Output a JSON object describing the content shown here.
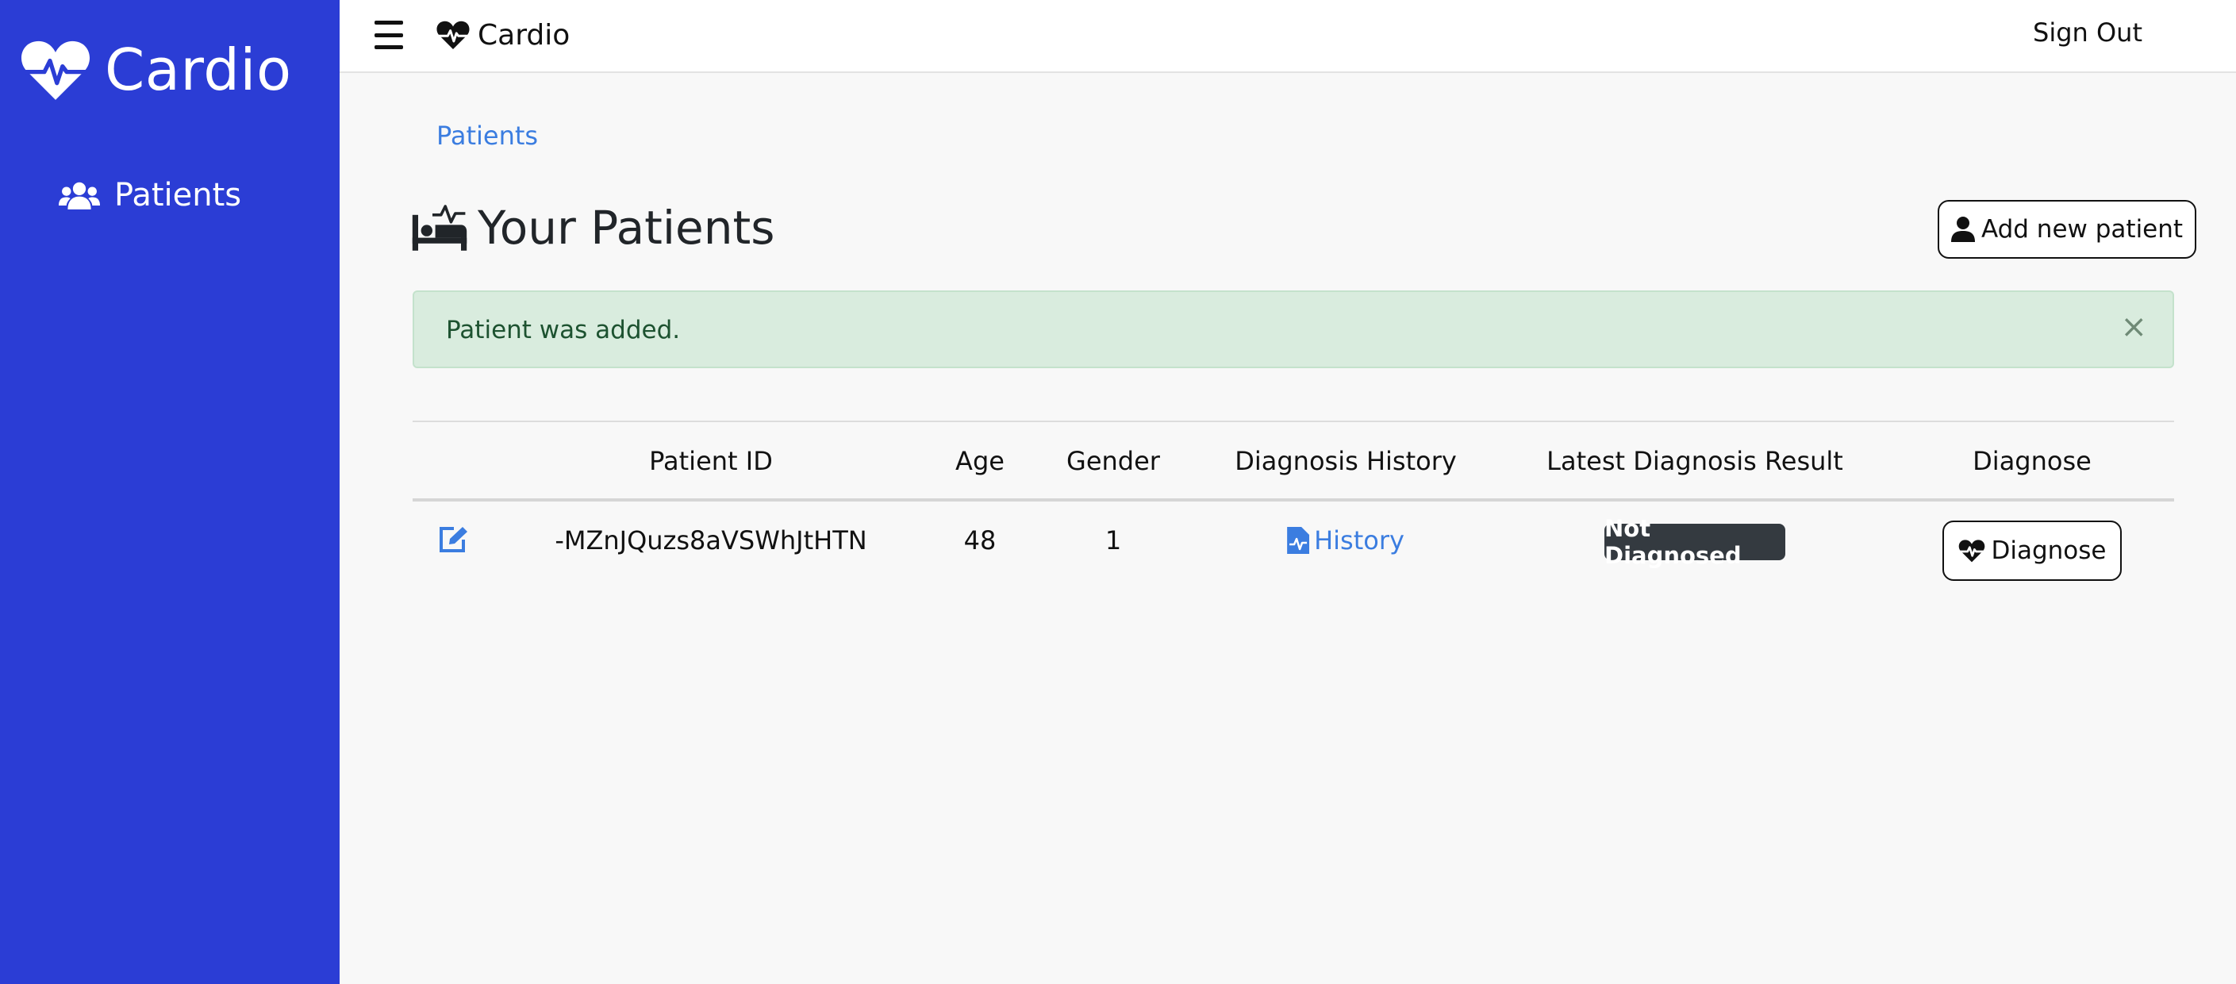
{
  "app": {
    "name": "Cardio"
  },
  "sidebar": {
    "items": [
      {
        "label": "Patients",
        "icon": "users-icon"
      }
    ]
  },
  "topbar": {
    "brand": "Cardio",
    "sign_out": "Sign Out"
  },
  "breadcrumb": "Patients",
  "page": {
    "title": "Your Patients",
    "title_icon": "bed-pulse-icon",
    "add_button": "Add new patient"
  },
  "alert": {
    "message": "Patient was added.",
    "close": "×"
  },
  "table": {
    "headers": [
      "Patient ID",
      "Age",
      "Gender",
      "Diagnosis History",
      "Latest Diagnosis Result",
      "Diagnose"
    ],
    "rows": [
      {
        "patient_id": "-MZnJQuzs8aVSWhJtHTN",
        "age": "48",
        "gender": "1",
        "history_label": "History",
        "result": "Not Diagnosed",
        "diagnose_label": "Diagnose"
      }
    ]
  },
  "colors": {
    "sidebar": "#2b3dd5",
    "link": "#3b7de0",
    "alert_bg": "#d9ecde",
    "badge": "#343a40"
  }
}
